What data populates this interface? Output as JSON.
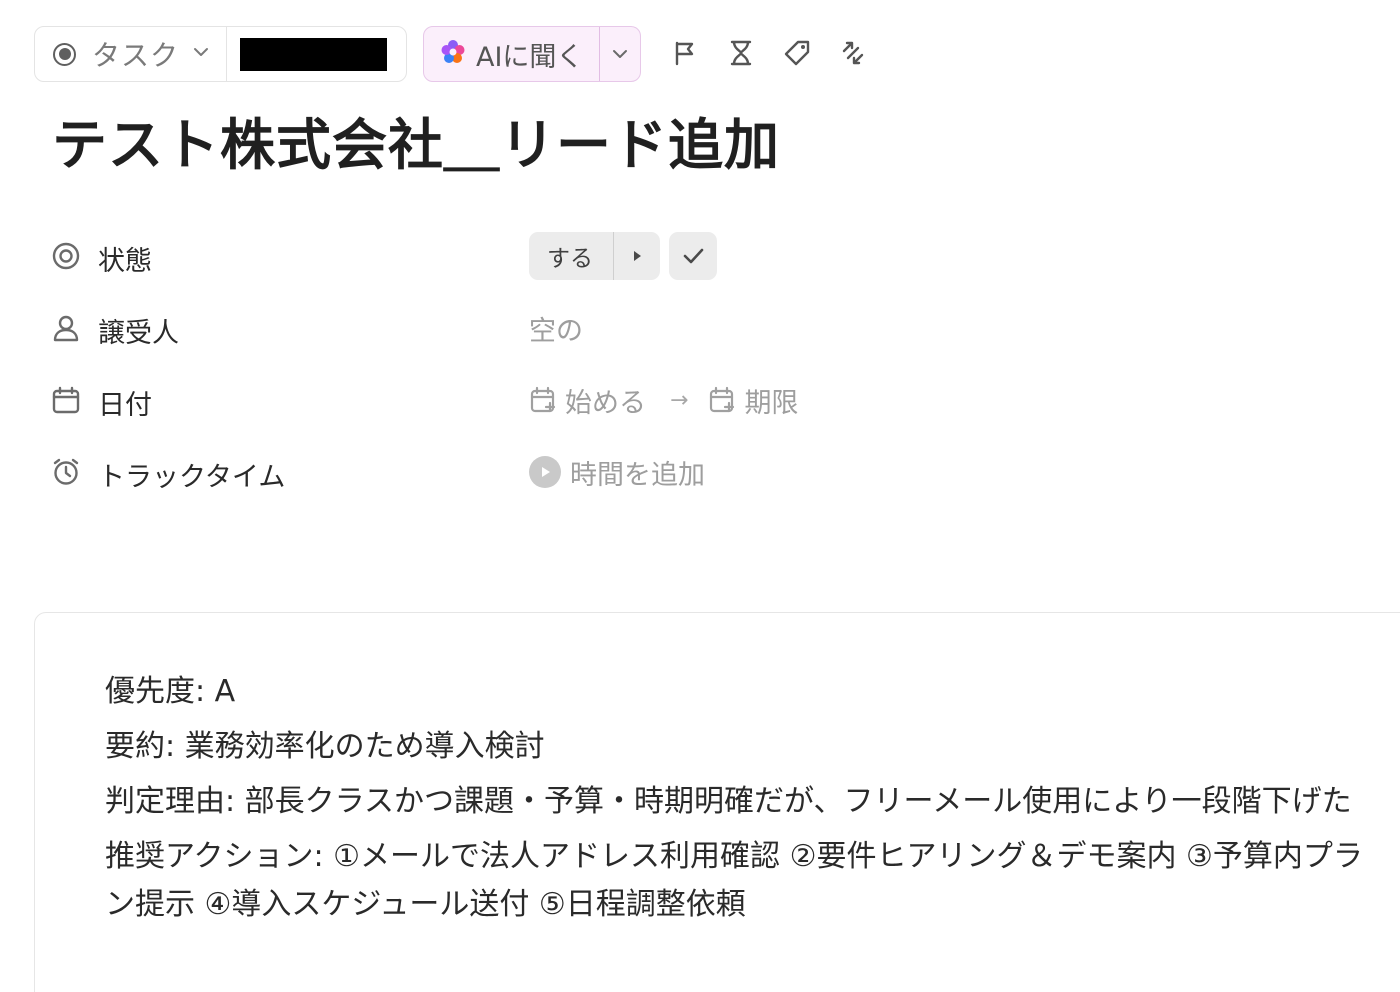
{
  "toolbar": {
    "type_label": "タスク",
    "ai_label": "AIに聞く",
    "icons": [
      "flag-icon",
      "hourglass-icon",
      "tag-icon",
      "relationship-icon"
    ]
  },
  "task": {
    "title": "テスト株式会社＿リード追加"
  },
  "properties": {
    "status": {
      "label": "状態",
      "value": "する"
    },
    "assignee": {
      "label": "譲受人",
      "value": "空の"
    },
    "dates": {
      "label": "日付",
      "start": "始める",
      "arrow": "→",
      "due": "期限"
    },
    "time": {
      "label": "トラックタイム",
      "value": "時間を追加"
    }
  },
  "description": {
    "lines": [
      "優先度: A",
      "要約: 業務効率化のため導入検討",
      "判定理由: 部長クラスかつ課題・予算・時期明確だが、フリーメール使用により一段階下げた",
      "推奨アクション: ①メールで法人アドレス利用確認 ②要件ヒアリング＆デモ案内 ③予算内プラン提示 ④導入スケジュール送付 ⑤日程調整依頼"
    ]
  },
  "colors": {
    "ai_bg": "#fbeffb",
    "ai_border": "#e7c8e9",
    "pill_bg": "#ececec",
    "muted_text": "#9e9e9e"
  }
}
